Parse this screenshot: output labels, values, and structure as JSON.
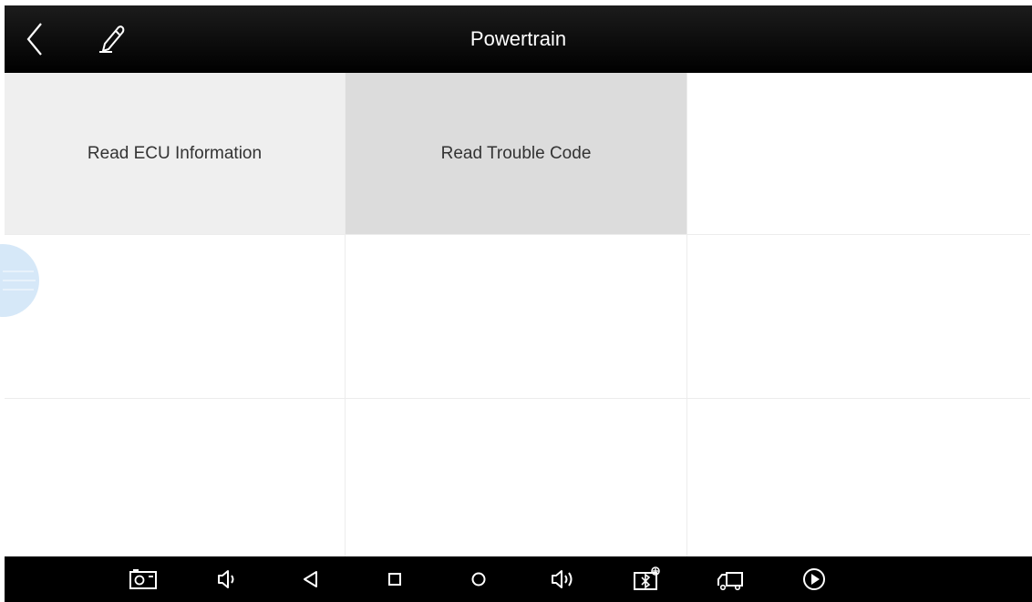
{
  "header": {
    "title": "Powertrain",
    "back_icon": "chevron-left-icon",
    "edit_icon": "pencil-icon"
  },
  "grid": {
    "cells": [
      {
        "label": "Read ECU Information",
        "state": "normal"
      },
      {
        "label": "Read Trouble Code",
        "state": "pressed"
      },
      {
        "label": ""
      },
      {
        "label": ""
      },
      {
        "label": ""
      },
      {
        "label": ""
      },
      {
        "label": ""
      },
      {
        "label": ""
      },
      {
        "label": ""
      }
    ]
  },
  "colors": {
    "header_bg": "#000000",
    "header_text": "#ffffff",
    "cell_ecu_bg": "#efefef",
    "cell_pressed_bg": "#dcdcdc",
    "floating_button": "#d6e8f8",
    "navbar_bg": "#000000"
  },
  "navbar": {
    "icons": [
      "screenshot-icon",
      "volume-down-icon",
      "back-icon",
      "recents-icon",
      "home-icon",
      "volume-up-icon",
      "vci-connection-icon",
      "truck-icon",
      "play-icon"
    ]
  }
}
